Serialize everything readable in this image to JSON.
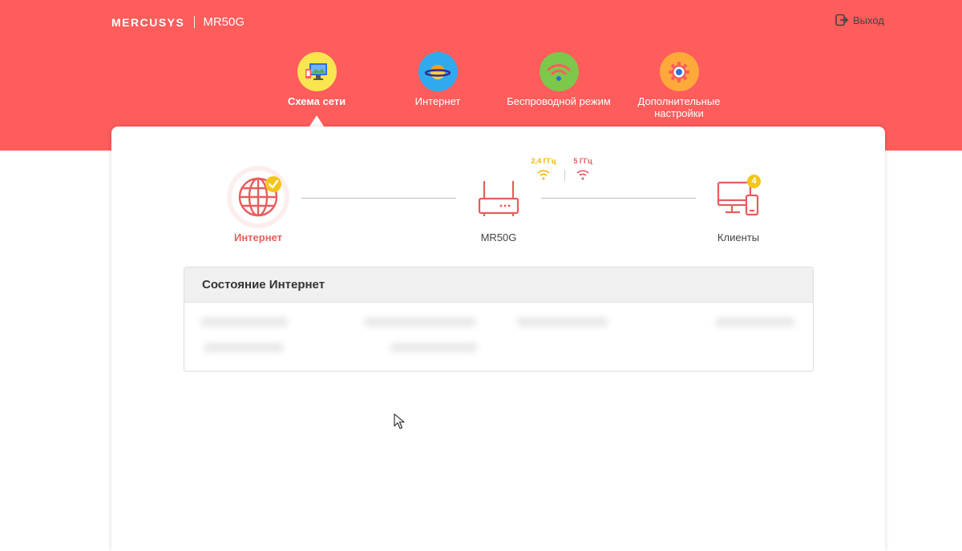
{
  "header": {
    "brand": "MERCUSYS",
    "model": "MR50G",
    "logout_label": "Выход"
  },
  "nav": {
    "items": [
      {
        "label": "Схема сети",
        "icon": "network-map-icon",
        "active": true
      },
      {
        "label": "Интернет",
        "icon": "internet-planet-icon",
        "active": false
      },
      {
        "label": "Беспроводной режим",
        "icon": "wireless-icon",
        "active": false
      },
      {
        "label": "Дополнительные настройки",
        "icon": "advanced-gear-icon",
        "active": false
      }
    ]
  },
  "topology": {
    "internet_label": "Интернет",
    "router_label": "MR50G",
    "clients_label": "Клиенты",
    "clients_count": "4",
    "band_24": "2,4 ГГц",
    "band_5": "5 ГГц"
  },
  "status": {
    "title": "Состояние Интернет"
  },
  "colors": {
    "header": "#ff5c5c",
    "accent_red": "#e85c5c",
    "accent_yellow": "#f5c518"
  }
}
